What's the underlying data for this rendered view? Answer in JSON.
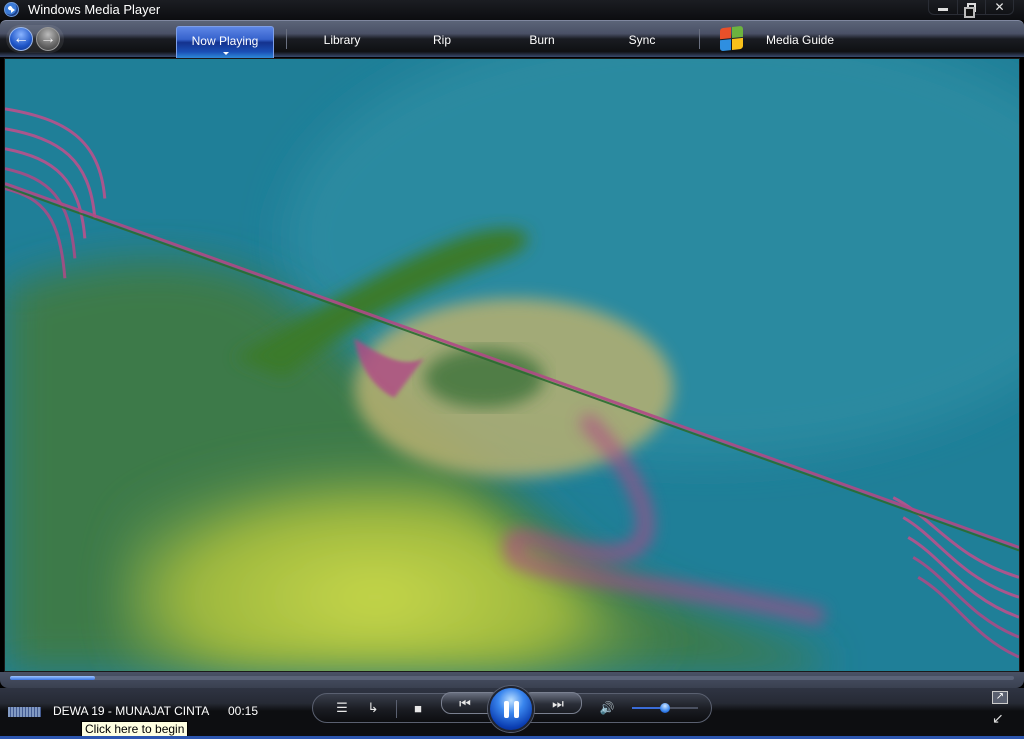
{
  "window": {
    "title": "Windows Media Player",
    "controls": {
      "minimize": "minimize",
      "restore": "restore",
      "close": "close"
    }
  },
  "nav": {
    "back_icon": "back-arrow-icon",
    "forward_icon": "forward-arrow-icon",
    "tabs": [
      {
        "label": "Now Playing",
        "active": true
      },
      {
        "label": "Library",
        "active": false
      },
      {
        "label": "Rip",
        "active": false
      },
      {
        "label": "Burn",
        "active": false
      },
      {
        "label": "Sync",
        "active": false
      },
      {
        "label": "Media Guide",
        "active": false
      }
    ]
  },
  "visualization": {
    "colors": {
      "background": "#1e7d96",
      "yellow": "#b9cc45",
      "green": "#2f6e2a",
      "magenta": "#b04a86",
      "sand": "#c8b77a"
    }
  },
  "seek": {
    "progress_fraction": 0.085
  },
  "player": {
    "track": "DEWA 19 - MUNAJAT CINTA",
    "elapsed": "00:15",
    "tooltip": "Click here to begin",
    "volume_fraction": 0.5,
    "buttons": {
      "playlist": "☰",
      "repeat": "↳",
      "stop": "■",
      "previous": "⏮",
      "next": "⏭",
      "mute": "🔊"
    },
    "accent_color": "#2c56b0"
  }
}
